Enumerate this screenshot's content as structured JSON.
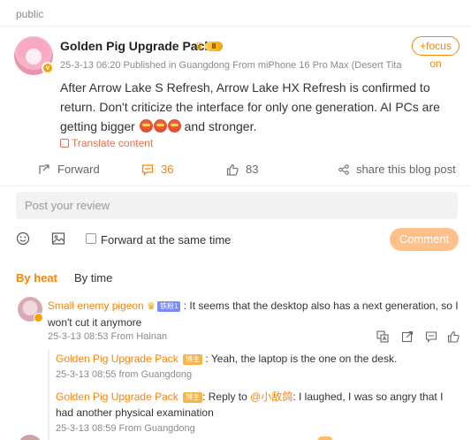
{
  "post": {
    "visibility": "public",
    "author": "Golden Pig Upgrade Pack",
    "vip_level": "Ⅱ",
    "follow_label": "+focus on",
    "meta": "25-3-13 06:20  Published in Guangdong  From miPhone 16 Pro Max (Desert Tita...",
    "text": "After Arrow Lake S Refresh, Arrow Lake HX Refresh is confirmed to return. Don't criticize the interface for only one generation. AI PCs are getting bigger",
    "text_end": "and stronger.",
    "emojis": [
      "emoji-hot",
      "emoji-hot",
      "emoji-hot"
    ],
    "translate_label": "Translate content"
  },
  "actions": {
    "forward_label": "Forward",
    "comment_count": "36",
    "like_count": "83",
    "share_label": "share this blog post"
  },
  "composer": {
    "placeholder": "Post your review",
    "forward_same_time_label": "Forward at the same time",
    "submit_label": "Comment"
  },
  "sort": {
    "by_heat": "By heat",
    "by_time": "By time"
  },
  "comments": [
    {
      "name": "Small enemy pigeon",
      "fan_badge": "铁粉1",
      "text": ": It seems that the desktop also has a next generation, so I won't cut it anymore",
      "meta": "25-3-13 08:53 From Hainan",
      "replies": [
        {
          "name": "Golden Pig Upgrade Pack",
          "badge": "博主",
          "text": ": Yeah, the laptop is the one on the desk.",
          "meta": "25-3-13 08:55 from Guangdong"
        },
        {
          "name": "Golden Pig Upgrade Pack",
          "badge": "博主",
          "text_prefix": ": Reply to ",
          "mention": "@小敌鸽",
          "text": ": I laughed, I was so angry that I had another physical examination",
          "meta": "25-3-13 08:59 From Guangdong"
        }
      ]
    }
  ],
  "colors": {
    "accent": "#ff8200",
    "comment_button": "#ffc089",
    "input_bg": "#f2f2f2"
  }
}
